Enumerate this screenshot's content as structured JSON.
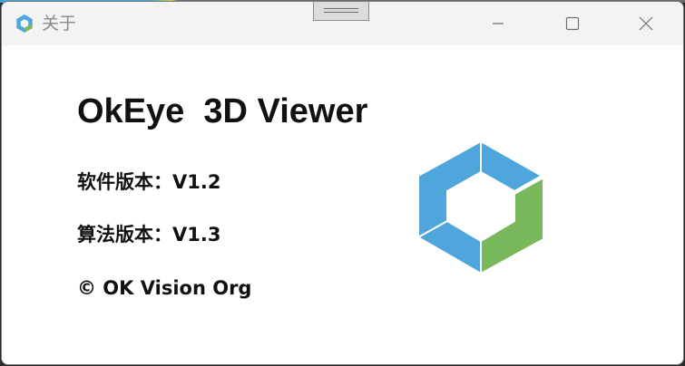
{
  "window": {
    "title": "关于"
  },
  "about": {
    "product_name": "OkEye  3D Viewer",
    "software_version_label": "软件版本：",
    "software_version": "V1.2",
    "algorithm_version_label": "算法版本：",
    "algorithm_version": "V1.3",
    "copyright": "© OK Vision Org"
  },
  "icons": {
    "app": "hexagon-logo-icon",
    "minimize": "minimize-icon",
    "maximize": "maximize-icon",
    "close": "close-icon",
    "drag": "drag-handle-icon"
  },
  "colors": {
    "logo_blue": "#4ea6dc",
    "logo_green": "#7ab85c",
    "titlebar_bg": "#f3f3f3",
    "text": "#111111"
  }
}
